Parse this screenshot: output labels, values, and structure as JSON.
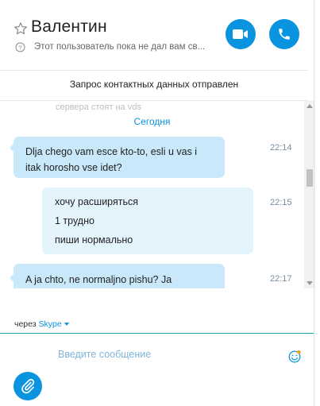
{
  "header": {
    "contact_name": "Валентин",
    "status": "Этот пользователь пока не дал вам св..."
  },
  "notice": {
    "request_sent": "Запрос контактных данных отправлен"
  },
  "chat": {
    "partial_previous": "сервера стоят на vds",
    "date_label": "Сегодня",
    "messages": [
      {
        "direction": "incoming",
        "text": "Dlja chego vam esce kto-to, esli u vas i itak horosho vse idet?",
        "time": "22:14"
      },
      {
        "direction": "outgoing",
        "lines": [
          "хочу расширяться",
          "1 трудно",
          "пиши нормально"
        ],
        "time": "22:15"
      },
      {
        "direction": "incoming",
        "text": "A ja chto, ne normaljno pishu? Ja",
        "time": "22:17"
      }
    ]
  },
  "compose": {
    "via_prefix": "через",
    "via_service": "Skype",
    "placeholder": "Введите сообщение"
  },
  "colors": {
    "accent": "#0a93de",
    "incoming_bubble": "#c9e9fa",
    "outgoing_bubble": "#e4f4fc"
  },
  "icons": {
    "favorite": "star-outline-icon",
    "info": "info-icon",
    "video": "video-camera-icon",
    "call": "phone-icon",
    "emoji": "emoji-icon",
    "attach": "paperclip-icon"
  }
}
